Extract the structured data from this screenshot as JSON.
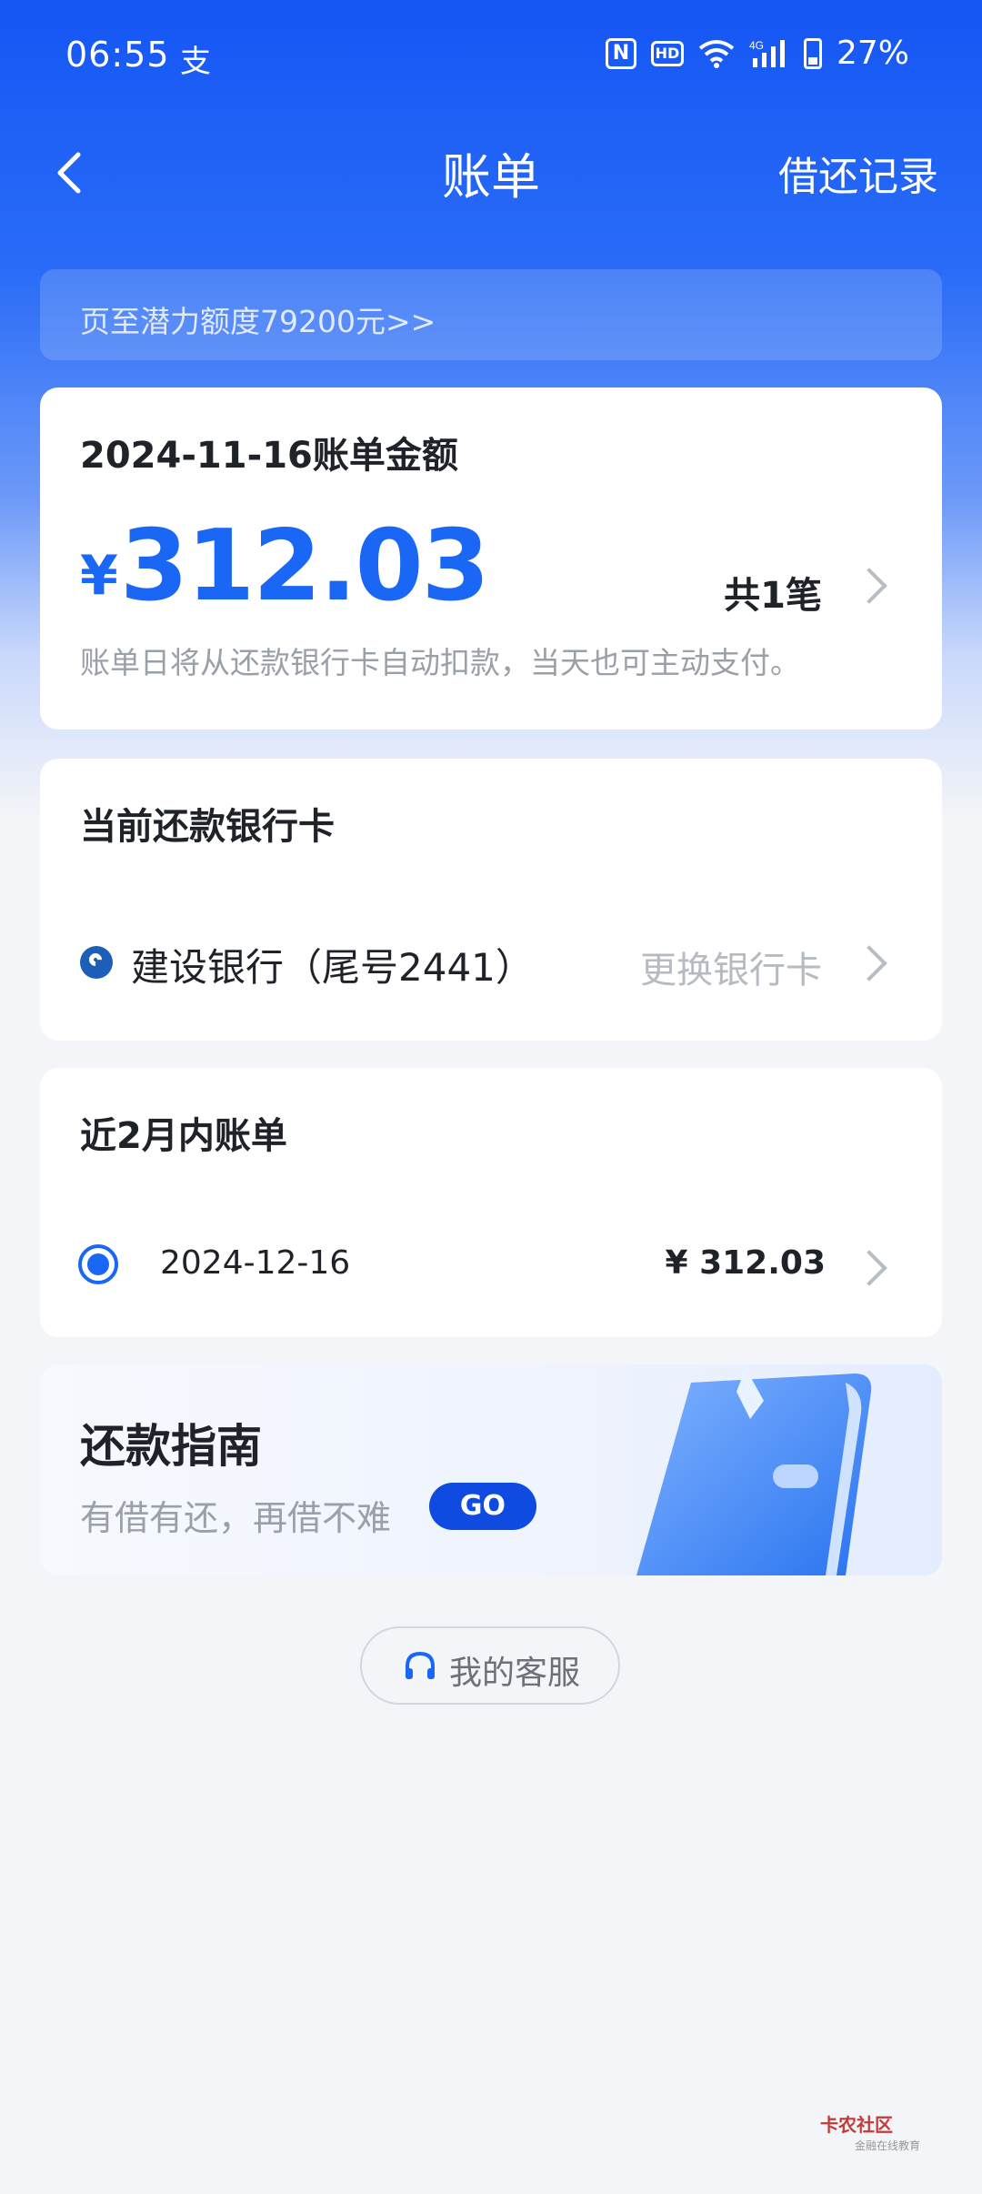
{
  "status_bar": {
    "time": "06:55",
    "app_icon_glyph": "支",
    "nfc": "N",
    "hd": "HD",
    "network": "4G",
    "battery": "27%"
  },
  "nav": {
    "title": "账单",
    "right_link": "借还记录"
  },
  "promo": {
    "text": "页至潜力额度79200元>>"
  },
  "bill": {
    "title": "2024-11-16账单金额",
    "currency": "¥",
    "amount": "312.03",
    "count": "共1笔",
    "description": "账单日将从还款银行卡自动扣款，当天也可主动支付。"
  },
  "bank": {
    "title": "当前还款银行卡",
    "name": "建设银行（尾号2441）",
    "change_label": "更换银行卡"
  },
  "recent": {
    "title": "近2月内账单",
    "items": [
      {
        "date": "2024-12-16",
        "amount": "¥ 312.03"
      }
    ]
  },
  "guide": {
    "title": "还款指南",
    "subtitle": "有借有还，再借不难",
    "go_label": "GO"
  },
  "service": {
    "label": "我的客服"
  },
  "watermark": {
    "text": "卡农社区",
    "sub": "金融在线教育"
  },
  "colors": {
    "accent": "#1a66f5",
    "header_blue": "#1556f5",
    "go_button": "#0f4be0"
  }
}
